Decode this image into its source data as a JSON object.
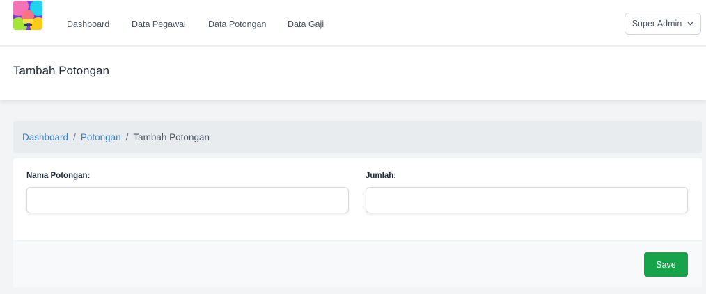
{
  "nav": {
    "links": [
      "Dashboard",
      "Data Pegawai",
      "Data Potongan",
      "Data Gaji"
    ],
    "user_label": "Super Admin"
  },
  "page": {
    "title": "Tambah Potongan"
  },
  "breadcrumb": {
    "items": [
      "Dashboard",
      "Potongan",
      "Tambah Potongan"
    ],
    "separator": "/"
  },
  "form": {
    "fields": [
      {
        "label": "Nama Potongan:",
        "value": "",
        "placeholder": ""
      },
      {
        "label": "Jumlah:",
        "value": "",
        "placeholder": ""
      }
    ],
    "save_label": "Save"
  },
  "colors": {
    "link": "#3b82c4",
    "save_button": "#16a34a",
    "breadcrumb_bg": "#e9ecef"
  },
  "icons": {
    "logo": "app-logo",
    "user_menu": "chevron-down-icon"
  }
}
